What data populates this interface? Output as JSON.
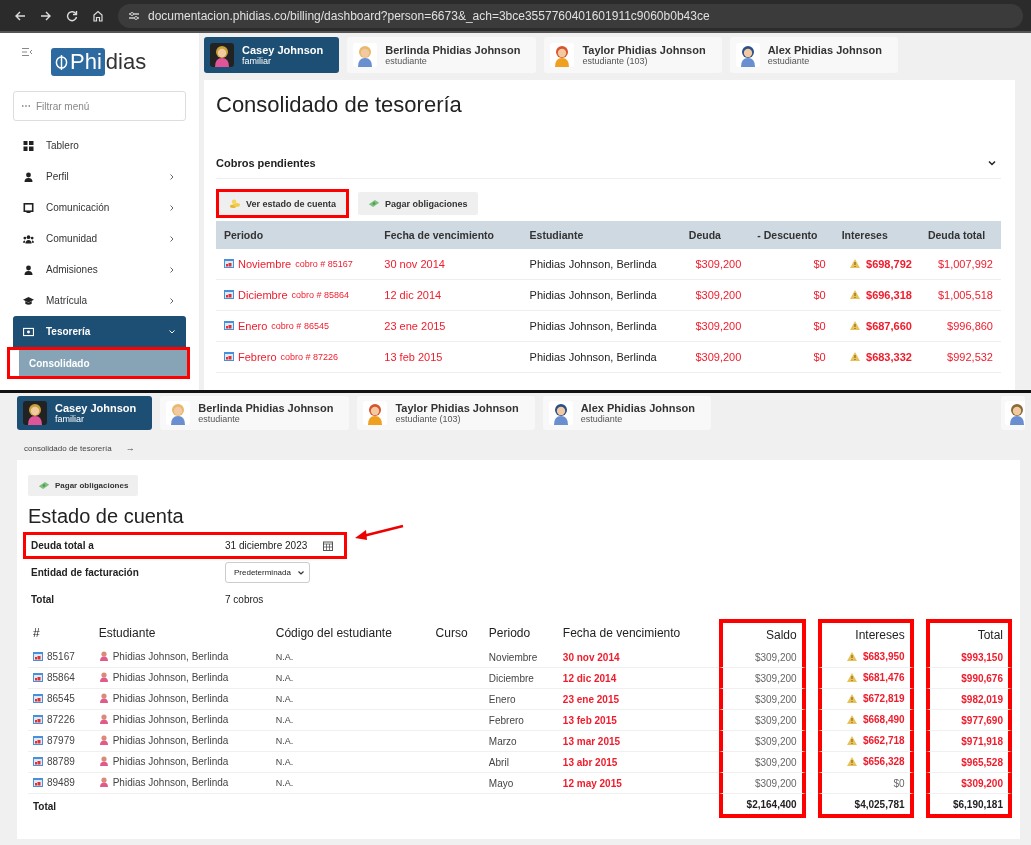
{
  "browser": {
    "url": "documentacion.phidias.co/billing/dashboard?person=6673&_ach=3bce3557760401601911c9060b0b43ce"
  },
  "sidebar": {
    "logo": {
      "boxed_part": "Phi",
      "rest": "dias"
    },
    "filter_placeholder": "Filtrar menú",
    "items": [
      {
        "label": "Tablero",
        "has_submenu": false,
        "selected": false
      },
      {
        "label": "Perfil",
        "has_submenu": true,
        "expanded": false,
        "selected": false
      },
      {
        "label": "Comunicación",
        "has_submenu": true,
        "expanded": false,
        "selected": false
      },
      {
        "label": "Comunidad",
        "has_submenu": true,
        "expanded": false,
        "selected": false
      },
      {
        "label": "Admisiones",
        "has_submenu": true,
        "expanded": false,
        "selected": false
      },
      {
        "label": "Matrícula",
        "has_submenu": true,
        "expanded": false,
        "selected": false
      },
      {
        "label": "Tesorería",
        "has_submenu": true,
        "expanded": true,
        "selected": true,
        "children": [
          {
            "label": "Consolidado",
            "selected": true,
            "highlighted": true
          }
        ]
      }
    ]
  },
  "people_top": [
    {
      "kind": "full",
      "name": "Casey Johnson",
      "role": "familiar",
      "selected": true
    },
    {
      "kind": "full",
      "name": "Berlinda Phidias Johnson",
      "role": "estudiante",
      "selected": false
    },
    {
      "kind": "full",
      "name": "Taylor Phidias Johnson",
      "role": "estudiante (103)",
      "selected": false
    },
    {
      "kind": "full",
      "name": "Alex Phidias Johnson",
      "role": "estudiante",
      "selected": false
    }
  ],
  "consolidado": {
    "title": "Consolidado de tesorería",
    "section": {
      "title": "Cobros pendientes",
      "expanded": true
    },
    "buttons": [
      {
        "label": "Ver estado de cuenta",
        "highlighted": true
      },
      {
        "label": "Pagar obligaciones",
        "highlighted": false
      }
    ],
    "columns": [
      "Periodo",
      "Fecha de vencimiento",
      "Estudiante",
      "Deuda",
      "- Descuento",
      "Intereses",
      "Deuda total"
    ],
    "rows": [
      {
        "periodo": "Noviembre",
        "cobro": "cobro # 85167",
        "fecha": "30 nov 2014",
        "estudiante": "Phidias Johnson, Berlinda",
        "deuda": "$309,200",
        "descuento": "$0",
        "intereses": "$698,792",
        "warning": true,
        "total": "$1,007,992"
      },
      {
        "periodo": "Diciembre",
        "cobro": "cobro # 85864",
        "fecha": "12 dic 2014",
        "estudiante": "Phidias Johnson, Berlinda",
        "deuda": "$309,200",
        "descuento": "$0",
        "intereses": "$696,318",
        "warning": true,
        "total": "$1,005,518"
      },
      {
        "periodo": "Enero",
        "cobro": "cobro # 86545",
        "fecha": "23 ene 2015",
        "estudiante": "Phidias Johnson, Berlinda",
        "deuda": "$309,200",
        "descuento": "$0",
        "intereses": "$687,660",
        "warning": true,
        "total": "$996,860"
      },
      {
        "periodo": "Febrero",
        "cobro": "cobro # 87226",
        "fecha": "13 feb 2015",
        "estudiante": "Phidias Johnson, Berlinda",
        "deuda": "$309,200",
        "descuento": "$0",
        "intereses": "$683,332",
        "warning": true,
        "total": "$992,532"
      }
    ]
  },
  "people_bottom": [
    {
      "kind": "full",
      "name": "Casey Johnson",
      "role": "familiar",
      "selected": true
    },
    {
      "kind": "full",
      "name": "Berlinda Phidias Johnson",
      "role": "estudiante",
      "selected": false
    },
    {
      "kind": "full",
      "name": "Taylor Phidias Johnson",
      "role": "estudiante (103)",
      "selected": false
    },
    {
      "kind": "full",
      "name": "Alex Phidias Johnson",
      "role": "estudiante",
      "selected": false
    },
    {
      "kind": "partial",
      "selected": false
    }
  ],
  "breadcrumb": {
    "label": "consolidado de tesorería",
    "arrow": "→"
  },
  "estado": {
    "button": {
      "label": "Pagar obligaciones"
    },
    "title": "Estado de cuenta",
    "fields": [
      {
        "kind": "date",
        "label": "Deuda total a",
        "value": "31 diciembre 2023",
        "highlighted": true,
        "pointer_arrow": true
      },
      {
        "kind": "select",
        "label": "Entidad de facturación",
        "value": "Predeterminada",
        "highlighted": false,
        "pointer_arrow": false
      },
      {
        "kind": "text",
        "label": "Total",
        "value": "7 cobros",
        "highlighted": false,
        "pointer_arrow": false
      }
    ],
    "columns": [
      {
        "label": "#",
        "highlighted": false
      },
      {
        "label": "Estudiante",
        "highlighted": false
      },
      {
        "label": "Código del estudiante",
        "highlighted": false
      },
      {
        "label": "Curso",
        "highlighted": false
      },
      {
        "label": "Periodo",
        "highlighted": false
      },
      {
        "label": "Fecha de vencimiento",
        "highlighted": false
      },
      {
        "label": "Saldo",
        "highlighted": true
      },
      {
        "label": "Intereses",
        "highlighted": true
      },
      {
        "label": "Total",
        "highlighted": true
      }
    ],
    "rows": [
      {
        "numero": "85167",
        "estudiante": "Phidias Johnson, Berlinda",
        "codigo": "N.A.",
        "periodo": "Noviembre",
        "fecha": "30 nov 2014",
        "saldo": "$309,200",
        "intereses": "$683,950",
        "warning": true,
        "total": "$993,150"
      },
      {
        "numero": "85864",
        "estudiante": "Phidias Johnson, Berlinda",
        "codigo": "N.A.",
        "periodo": "Diciembre",
        "fecha": "12 dic 2014",
        "saldo": "$309,200",
        "intereses": "$681,476",
        "warning": true,
        "total": "$990,676"
      },
      {
        "numero": "86545",
        "estudiante": "Phidias Johnson, Berlinda",
        "codigo": "N.A.",
        "periodo": "Enero",
        "fecha": "23 ene 2015",
        "saldo": "$309,200",
        "intereses": "$672,819",
        "warning": true,
        "total": "$982,019"
      },
      {
        "numero": "87226",
        "estudiante": "Phidias Johnson, Berlinda",
        "codigo": "N.A.",
        "periodo": "Febrero",
        "fecha": "13 feb 2015",
        "saldo": "$309,200",
        "intereses": "$668,490",
        "warning": true,
        "total": "$977,690"
      },
      {
        "numero": "87979",
        "estudiante": "Phidias Johnson, Berlinda",
        "codigo": "N.A.",
        "periodo": "Marzo",
        "fecha": "13 mar 2015",
        "saldo": "$309,200",
        "intereses": "$662,718",
        "warning": true,
        "total": "$971,918"
      },
      {
        "numero": "88789",
        "estudiante": "Phidias Johnson, Berlinda",
        "codigo": "N.A.",
        "periodo": "Abril",
        "fecha": "13 abr 2015",
        "saldo": "$309,200",
        "intereses": "$656,328",
        "warning": true,
        "total": "$965,528"
      },
      {
        "numero": "89489",
        "estudiante": "Phidias Johnson, Berlinda",
        "codigo": "N.A.",
        "periodo": "Mayo",
        "fecha": "12 may 2015",
        "saldo": "$309,200",
        "intereses": "$0",
        "warning": false,
        "total": "$309,200"
      }
    ],
    "totals": {
      "label": "Total",
      "saldo": "$2,164,400",
      "intereses": "$4,025,781",
      "total": "$6,190,181"
    }
  }
}
